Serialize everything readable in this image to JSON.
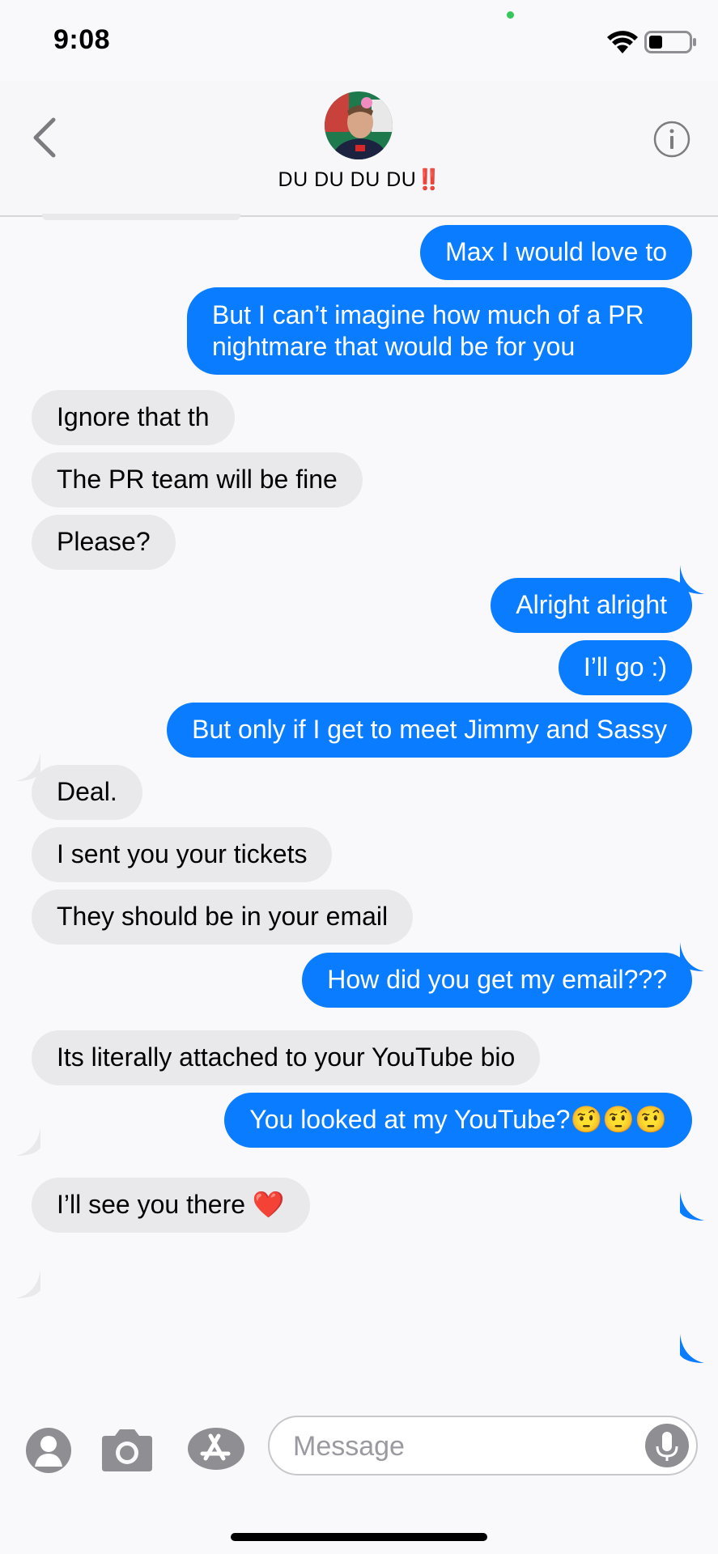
{
  "status_bar": {
    "time": "9:08",
    "wifi_icon": "wifi-icon",
    "battery_icon": "battery-icon",
    "battery_level": 0.35
  },
  "header": {
    "contact_name": "DU DU DU DU",
    "contact_name_suffix": "‼️",
    "back_icon": "chevron-left-icon",
    "info_icon": "info-icon",
    "avatar_icon": "contact-photo"
  },
  "messages": [
    {
      "from": "me",
      "text": "Max I would love to"
    },
    {
      "from": "me",
      "text": "But I can’t imagine how much of a PR nightmare that would be for you"
    },
    {
      "from": "them",
      "text": "Ignore that th"
    },
    {
      "from": "them",
      "text": "The PR team will be fine"
    },
    {
      "from": "them",
      "text": "Please?"
    },
    {
      "from": "me",
      "text": "Alright alright"
    },
    {
      "from": "me",
      "text": "I’ll go :)"
    },
    {
      "from": "me",
      "text": "But only if I get to meet Jimmy and Sassy"
    },
    {
      "from": "them",
      "text": "Deal."
    },
    {
      "from": "them",
      "text": "I sent you your tickets"
    },
    {
      "from": "them",
      "text": "They should be in your email"
    },
    {
      "from": "me",
      "text": "How did you get my email???"
    },
    {
      "from": "them",
      "text": "Its literally attached to your YouTube bio"
    },
    {
      "from": "me",
      "text": "You looked at my YouTube?🤨🤨🤨"
    },
    {
      "from": "them",
      "text": "I’ll see you there ❤️"
    }
  ],
  "input_bar": {
    "placeholder": "Message",
    "contact_icon": "contact-app-icon",
    "camera_icon": "camera-icon",
    "appstore_icon": "appstore-icon",
    "mic_icon": "microphone-icon"
  },
  "colors": {
    "sent_bubble": "#0a7cff",
    "received_bubble": "#e9e9eb",
    "background": "#f9f9fb"
  }
}
